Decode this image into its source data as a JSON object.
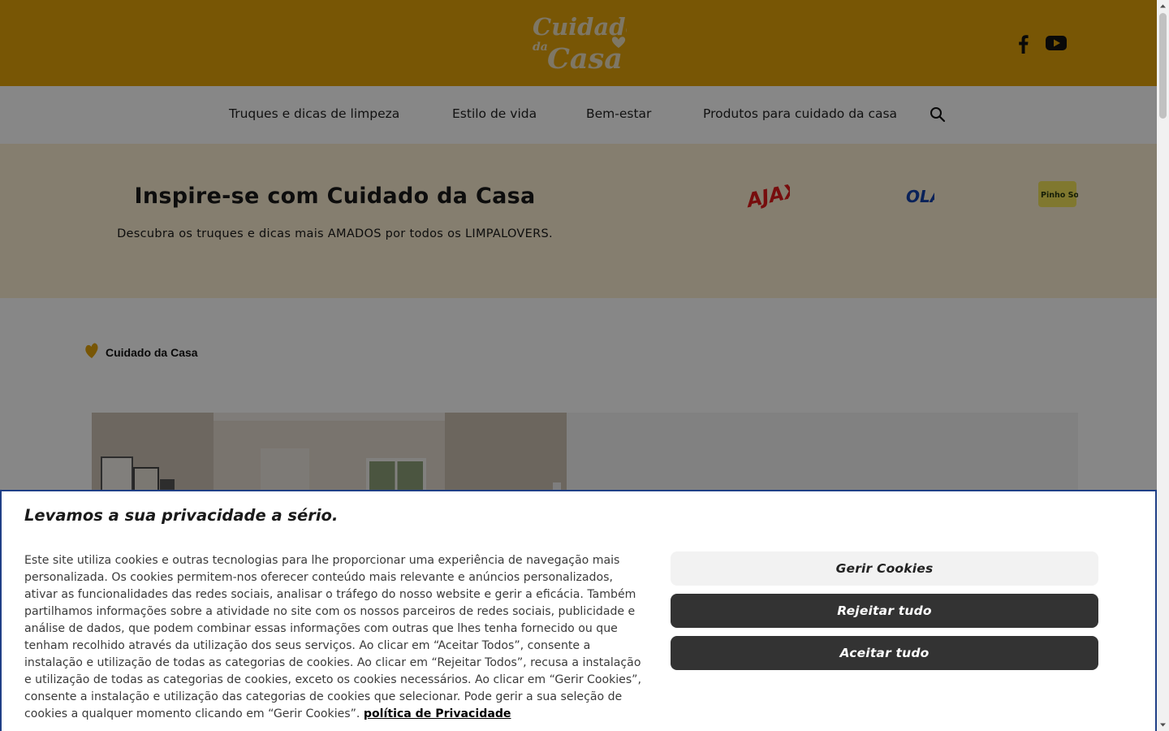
{
  "header": {
    "logo_text_line1": "Cuidado",
    "logo_text_da": "da",
    "logo_text_line2": "Casa",
    "social": [
      "facebook-icon",
      "youtube-icon"
    ]
  },
  "nav": {
    "items": [
      {
        "label": "Truques e dicas de limpeza"
      },
      {
        "label": "Estilo de vida"
      },
      {
        "label": "Bem-estar"
      },
      {
        "label": "Produtos para cuidado da casa"
      }
    ],
    "search_icon": "search-icon"
  },
  "hero": {
    "title": "Inspire-se com Cuidado da Casa",
    "subtitle": "Descubra os truques e dicas mais AMADOS por todos os LIMPALOVERS.",
    "brands": [
      "AJAX",
      "OLA",
      "Pinho Sol"
    ]
  },
  "breadcrumb": {
    "label": "Cuidado da Casa"
  },
  "cookie": {
    "title": "Levamos a sua privacidade a sério.",
    "body": "Este site utiliza cookies e outras tecnologias para lhe proporcionar uma experiência de navegação mais personalizada. Os cookies permitem-nos oferecer conteúdo mais relevante e anúncios personalizados, ativar as funcionalidades das redes sociais, analisar o tráfego do nosso website e gerir a eficácia. Também partilhamos informações sobre a atividade no site com os nossos parceiros de redes sociais, publicidade e análise de dados, que podem combinar essas informações com outras que lhes tenha fornecido ou que tenham recolhido através da utilização dos seus serviços. Ao clicar em “Aceitar Todos”, consente a instalação e utilização de todas as categorias de cookies. Ao clicar em “Rejeitar Todos”, recusa a instalação e utilização de todas as categorias de cookies, exceto os cookies necessários. Ao clicar em “Gerir Cookies”, consente a instalação e utilização das categorias de cookies que selecionar. Pode gerir a sua seleção de cookies a qualquer momento clicando em “Gerir Cookies”.",
    "policy_link": "política de Privacidade",
    "manage_label": "Gerir Cookies",
    "reject_label": "Rejeitar tudo",
    "accept_label": "Aceitar tudo"
  },
  "colors": {
    "brand_yellow": "#e2a30b",
    "hero_bg": "#fbeed2",
    "dark_button": "#333333",
    "banner_border": "#1f3f86"
  }
}
